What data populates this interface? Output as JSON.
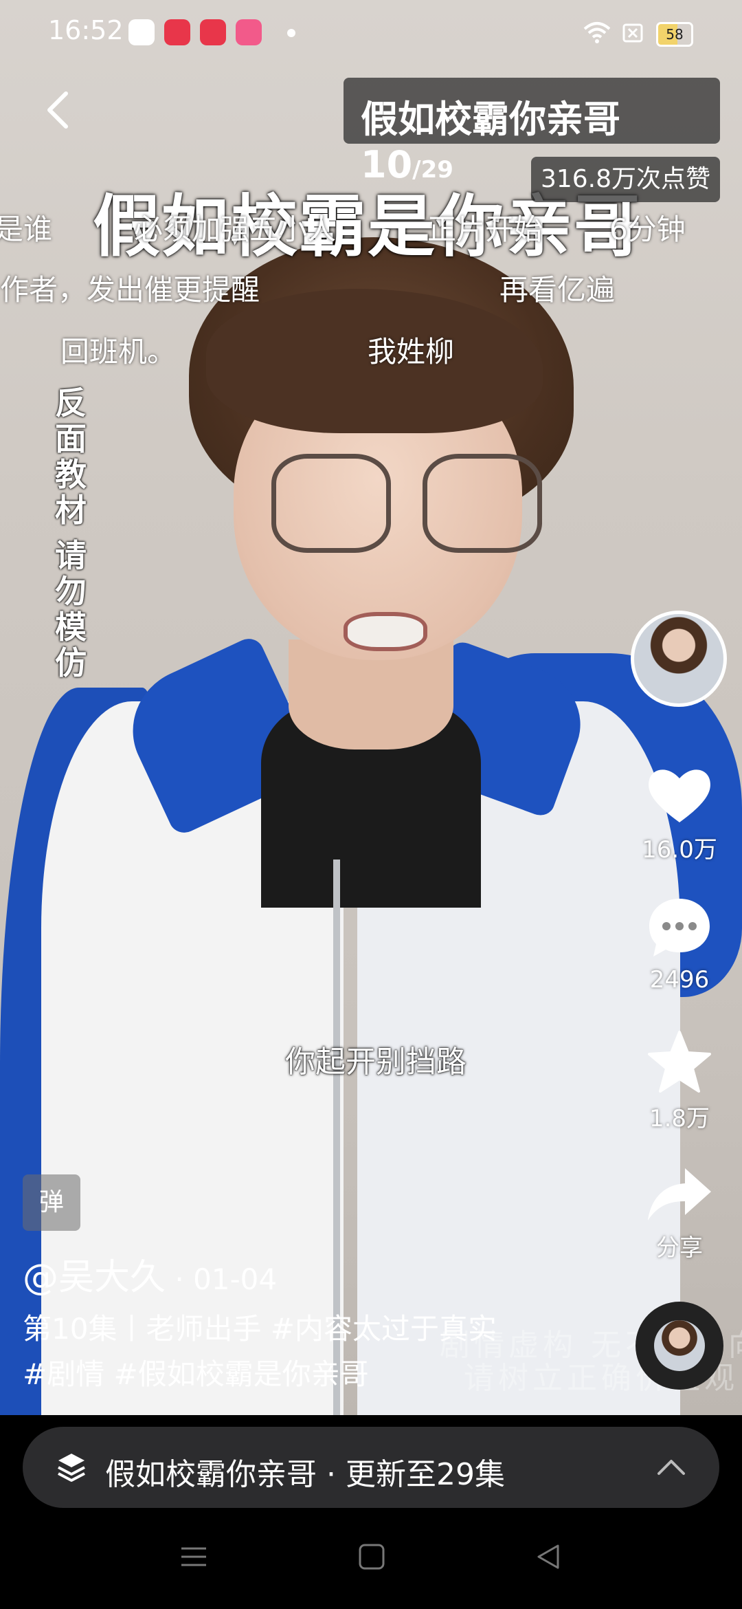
{
  "status_bar": {
    "time": "16:52",
    "battery": "58",
    "app_icons": [
      "red-envelope-app-icon",
      "video-app-icon",
      "video-app-icon-2",
      "bilibili-like-app-icon"
    ]
  },
  "header": {
    "drama_title": "假如校霸你亲哥 10",
    "episode_total": "/29",
    "likes_total": "316.8万次点赞"
  },
  "video_overlay": {
    "big_title": "假如校霸是你亲哥",
    "danmaku": [
      "是谁",
      "必须加强五小人",
      "正片开始",
      "6分钟",
      "作者，发出催更提醒",
      "再看亿遍",
      "回班机。",
      "我姓柳"
    ],
    "vertical_notice_1": "反面教材",
    "vertical_notice_2": "请勿模仿",
    "subtitle": "你起开别挡路",
    "watermark_1": "剧情虚构 无不良导向",
    "watermark_2": "请树立正确价值观"
  },
  "side_actions": {
    "like_count": "16.0万",
    "comment_count": "2496",
    "favorite_count": "1.8万",
    "share_label": "分享"
  },
  "post": {
    "tag_button": "弹",
    "author": "@吴大久",
    "date": " · 01-04",
    "caption_line1": "第10集丨老师出手 #内容太过于真实",
    "caption_line2": "#剧情 #假如校霸是你亲哥"
  },
  "series_bar": {
    "label": "假如校霸你亲哥 · 更新至29集"
  },
  "colors": {
    "jacket_blue": "#1e52bf",
    "pill_bg": "#2c2c2e"
  }
}
